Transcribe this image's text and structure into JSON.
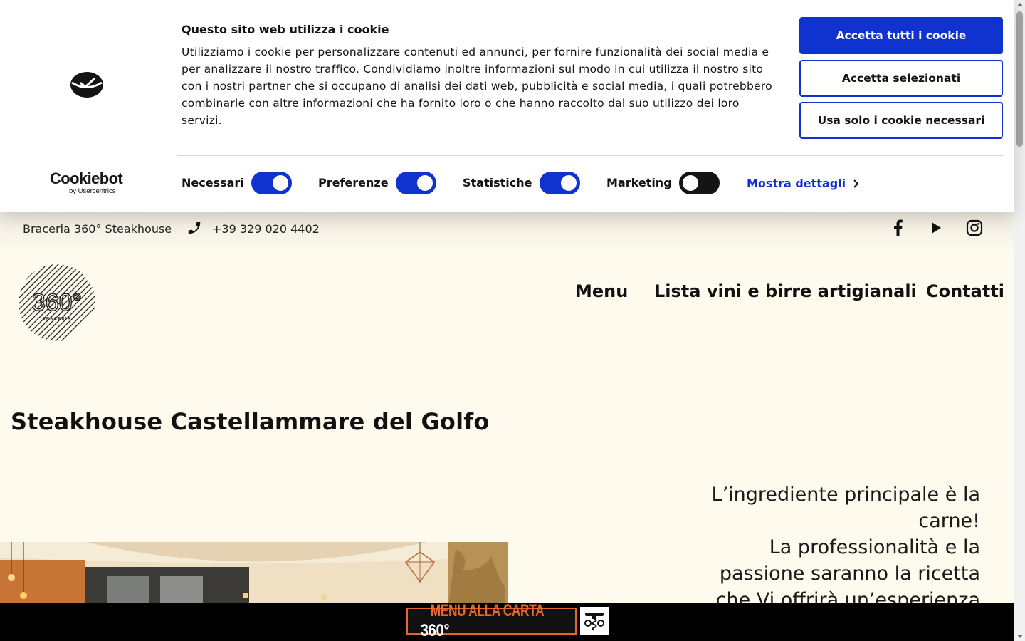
{
  "cookie_banner": {
    "title": "Questo sito web utilizza i cookie",
    "text": "Utilizziamo i cookie per personalizzare contenuti ed annunci, per fornire funzionalità dei social media e per analizzare il nostro traffico. Condividiamo inoltre informazioni sul modo in cui utilizza il nostro sito con i nostri partner che si occupano di analisi dei dati web, pubblicità e social media, i quali potrebbero combinarle con altre informazioni che ha fornito loro o che hanno raccolto dal suo utilizzo dei loro servizi.",
    "buttons": {
      "accept_all": "Accetta tutti i cookie",
      "accept_selected": "Accetta selezionati",
      "necessary_only": "Usa solo i cookie necessari"
    },
    "logo": {
      "main": "Cookiebot",
      "sub": "by Usercentrics"
    },
    "toggles": [
      {
        "label": "Necessari",
        "on": true
      },
      {
        "label": "Preferenze",
        "on": true
      },
      {
        "label": "Statistiche",
        "on": true
      },
      {
        "label": "Marketing",
        "on": false
      }
    ],
    "show_details": "Mostra dettagli",
    "accent_color": "#1032cf"
  },
  "topbar": {
    "brand": "Braceria 360° Steakhouse",
    "phone": "+39 329 020 4402",
    "social_icons": [
      "facebook-icon",
      "youtube-icon",
      "instagram-icon"
    ]
  },
  "nav": {
    "items": [
      "Menu",
      "Lista vini e birre artigianali",
      "Contatti"
    ]
  },
  "logo": {
    "number": "360°",
    "word": "BRACERIA"
  },
  "main": {
    "heading": "Steakhouse Castellammare del Golfo",
    "quote_line1": "L’ingrediente principale è la carne!",
    "quote_line2": "La professionalità e la passione saranno la ricetta che Vi offrirà un’esperienza"
  },
  "bottom_bar": {
    "menu_label": "MENU ALLA CARTA",
    "menu_number": "360°",
    "accent_color": "#e8662a"
  }
}
